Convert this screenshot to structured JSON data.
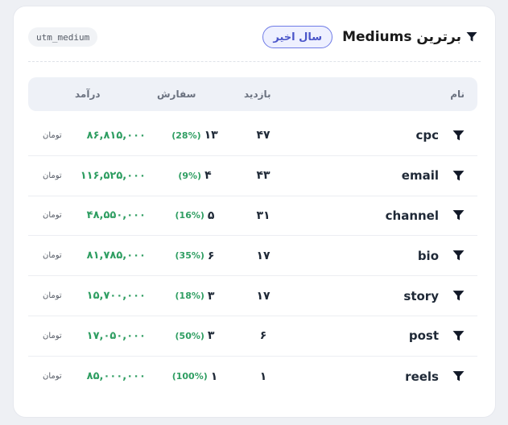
{
  "header": {
    "title": "برترین Mediums",
    "range": "سال اخیر",
    "tag": "utm_medium"
  },
  "table": {
    "columns": {
      "name": "نام",
      "visits": "بازدید",
      "orders": "سفارش",
      "revenue": "درآمد"
    },
    "currency": "تومان",
    "rows": [
      {
        "name": "cpc",
        "visits": "۴۷",
        "orders": "۱۳",
        "pct": "(28%)",
        "revenue": "۸۶,۸۱۵,۰۰۰"
      },
      {
        "name": "email",
        "visits": "۴۳",
        "orders": "۴",
        "pct": "(9%)",
        "revenue": "۱۱۶,۵۲۵,۰۰۰"
      },
      {
        "name": "channel",
        "visits": "۳۱",
        "orders": "۵",
        "pct": "(16%)",
        "revenue": "۴۸,۵۵۰,۰۰۰"
      },
      {
        "name": "bio",
        "visits": "۱۷",
        "orders": "۶",
        "pct": "(35%)",
        "revenue": "۸۱,۷۸۵,۰۰۰"
      },
      {
        "name": "story",
        "visits": "۱۷",
        "orders": "۳",
        "pct": "(18%)",
        "revenue": "۱۵,۷۰۰,۰۰۰"
      },
      {
        "name": "post",
        "visits": "۶",
        "orders": "۳",
        "pct": "(50%)",
        "revenue": "۱۷,۰۵۰,۰۰۰"
      },
      {
        "name": "reels",
        "visits": "۱",
        "orders": "۱",
        "pct": "(100%)",
        "revenue": "۸۵,۰۰۰,۰۰۰"
      }
    ]
  },
  "icons": {
    "title": "funnel-icon",
    "row": "funnel-icon"
  },
  "colors": {
    "accent": "#4a55c9",
    "positive": "#2f9e62"
  }
}
